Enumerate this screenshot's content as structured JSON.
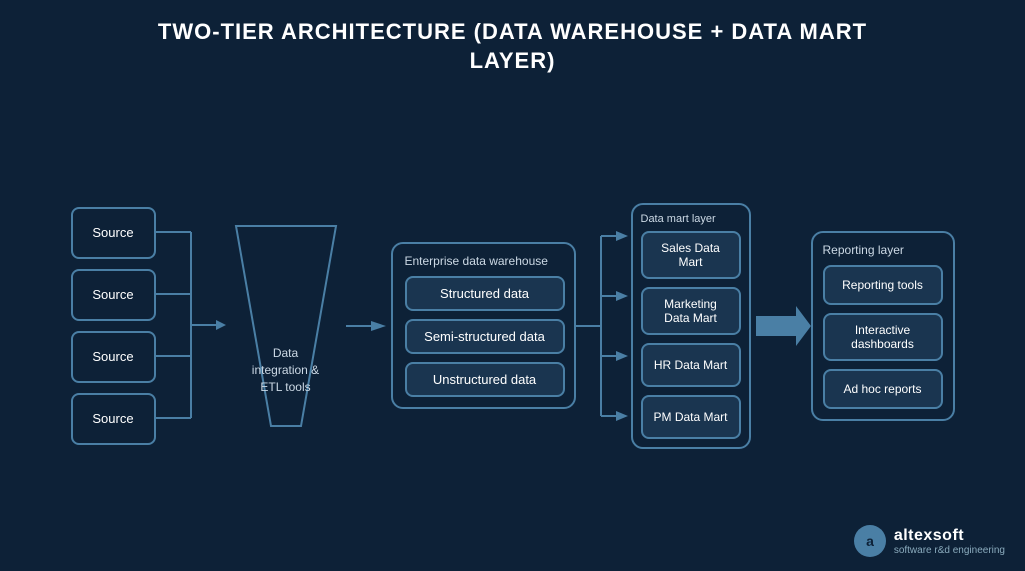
{
  "title": {
    "line1": "TWO-TIER ARCHITECTURE (DATA WAREHOUSE + DATA MART",
    "line2": "LAYER)"
  },
  "sources": [
    {
      "label": "Source"
    },
    {
      "label": "Source"
    },
    {
      "label": "Source"
    },
    {
      "label": "Source"
    }
  ],
  "etl": {
    "label": "Data\nintegration &\nETL tools"
  },
  "enterprise_dw": {
    "group_label": "Enterprise data warehouse",
    "items": [
      {
        "label": "Structured data"
      },
      {
        "label": "Semi-structured data"
      },
      {
        "label": "Unstructured data"
      }
    ]
  },
  "data_mart_layer": {
    "group_label": "Data mart layer",
    "items": [
      {
        "label": "Sales Data Mart"
      },
      {
        "label": "Marketing Data Mart"
      },
      {
        "label": "HR Data Mart"
      },
      {
        "label": "PM Data Mart"
      }
    ]
  },
  "reporting_layer": {
    "group_label": "Reporting layer",
    "items": [
      {
        "label": "Reporting tools"
      },
      {
        "label": "Interactive dashboards"
      },
      {
        "label": "Ad hoc reports"
      }
    ]
  },
  "logo": {
    "icon": "a",
    "name": "altexsoft",
    "sub": "software r&d engineering"
  }
}
